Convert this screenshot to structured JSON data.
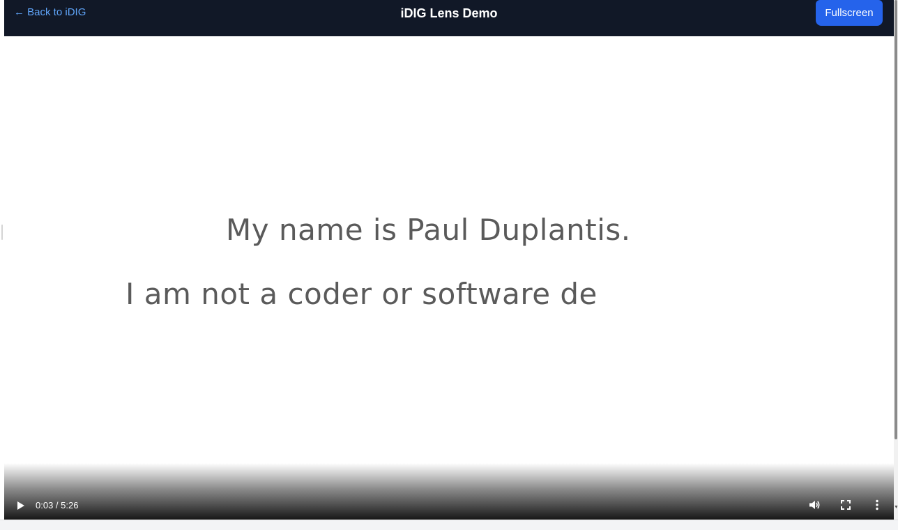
{
  "header": {
    "back_link": "← Back to iDIG",
    "title": "iDIG Lens Demo",
    "fullscreen_label": "Fullscreen"
  },
  "video": {
    "caption_line_1": "My name is Paul Duplantis.",
    "caption_line_2": "I am not a coder or software de",
    "current_time": "0:03",
    "duration": "5:26",
    "time_display": "0:03 / 5:26"
  },
  "icons": {
    "play": "play-icon",
    "volume": "volume-icon",
    "fullscreen": "fullscreen-icon",
    "more": "more-vert-icon"
  },
  "colors": {
    "header_bg": "#111827",
    "link": "#60a5fa",
    "button": "#2563eb",
    "caption_text": "#5a5a5a"
  }
}
